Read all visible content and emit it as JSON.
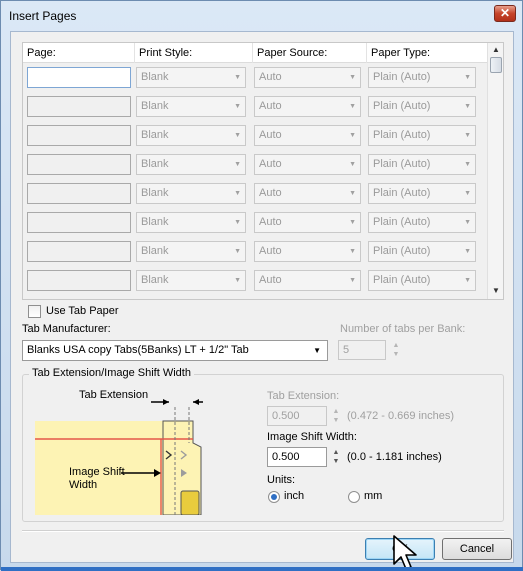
{
  "window": {
    "title": "Insert Pages",
    "close_label": "✕"
  },
  "table": {
    "columns": [
      "Page:",
      "Print Style:",
      "Paper Source:",
      "Paper Type:"
    ],
    "rows": [
      {
        "page": "",
        "print_style": "Blank",
        "paper_source": "Auto",
        "paper_type": "Plain (Auto)"
      },
      {
        "page": "",
        "print_style": "Blank",
        "paper_source": "Auto",
        "paper_type": "Plain (Auto)"
      },
      {
        "page": "",
        "print_style": "Blank",
        "paper_source": "Auto",
        "paper_type": "Plain (Auto)"
      },
      {
        "page": "",
        "print_style": "Blank",
        "paper_source": "Auto",
        "paper_type": "Plain (Auto)"
      },
      {
        "page": "",
        "print_style": "Blank",
        "paper_source": "Auto",
        "paper_type": "Plain (Auto)"
      },
      {
        "page": "",
        "print_style": "Blank",
        "paper_source": "Auto",
        "paper_type": "Plain (Auto)"
      },
      {
        "page": "",
        "print_style": "Blank",
        "paper_source": "Auto",
        "paper_type": "Plain (Auto)"
      },
      {
        "page": "",
        "print_style": "Blank",
        "paper_source": "Auto",
        "paper_type": "Plain (Auto)"
      }
    ]
  },
  "tab_paper": {
    "use_tab_paper_label": "Use Tab Paper",
    "use_tab_paper_checked": false,
    "manufacturer_label": "Tab Manufacturer:",
    "manufacturer_value": "Blanks USA copy Tabs(5Banks) LT + 1/2\"  Tab",
    "tabs_per_bank_label": "Number of tabs per Bank:",
    "tabs_per_bank_value": "5"
  },
  "shift_group": {
    "title": "Tab Extension/Image Shift Width",
    "diagram_tab_extension": "Tab Extension",
    "diagram_image_shift": "Image Shift",
    "diagram_width": "Width",
    "tab_extension_label": "Tab Extension:",
    "tab_extension_value": "0.500",
    "tab_extension_range": "(0.472 - 0.669 inches)",
    "image_shift_label": "Image Shift Width:",
    "image_shift_value": "0.500",
    "image_shift_range": "(0.0 - 1.181 inches)",
    "units_label": "Units:",
    "unit_inch": "inch",
    "unit_mm": "mm",
    "selected_unit": "inch"
  },
  "buttons": {
    "ok": "OK",
    "cancel": "Cancel"
  },
  "colors": {
    "accent": "#2f6fc4",
    "diagram_fill": "#fdf3b4",
    "diagram_line": "#e4574a"
  }
}
